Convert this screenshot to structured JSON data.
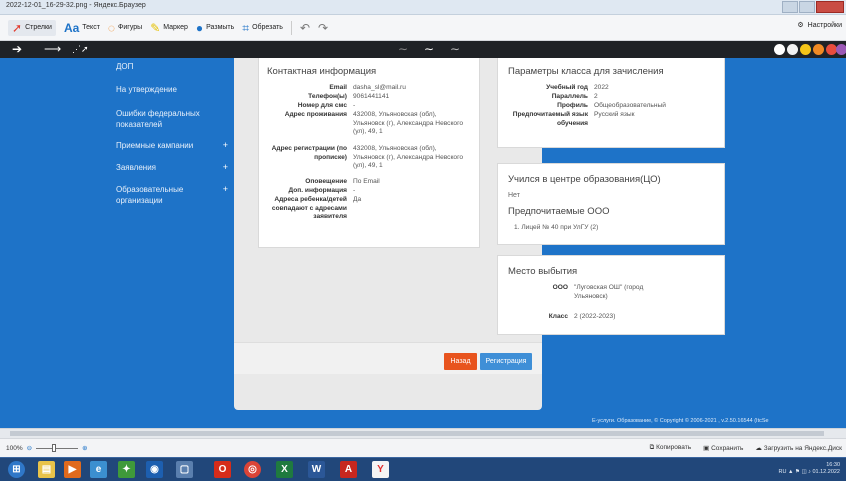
{
  "window": {
    "title": "2022-12-01_16-29-32.png - Яндекс.Браузер"
  },
  "toolbar": {
    "arrows": "Стрелки",
    "text": "Текст",
    "shapes": "Фигуры",
    "marker": "Маркер",
    "blur": "Размыть",
    "crop": "Обрезать",
    "settings": "Настройки"
  },
  "palette": [
    "#ffffff",
    "#f2f2f2",
    "#f5c518",
    "#f08a24",
    "#e84c3d",
    "#9b59b6",
    "#2ecc71"
  ],
  "sidebar": {
    "items": [
      {
        "label": "ДОП",
        "plus": ""
      },
      {
        "label": "На утверждение",
        "plus": ""
      },
      {
        "label": "Ошибки федеральных показателей",
        "plus": ""
      },
      {
        "label": "Приемные кампании",
        "plus": "+"
      },
      {
        "label": "Заявления",
        "plus": "+"
      },
      {
        "label": "Образовательные организации",
        "plus": "+"
      }
    ]
  },
  "contact": {
    "title": "Контактная информация",
    "rows": [
      {
        "k": "Email",
        "v": "dasha_sl@mail.ru"
      },
      {
        "k": "Телефон(ы)",
        "v": "9061441141"
      },
      {
        "k": "Номер для смс",
        "v": "-"
      },
      {
        "k": "Адрес проживания",
        "v": "432008, Ульяновская (обл), Ульяновск (г), Александра Невского (ул), 49, 1"
      },
      {
        "k": "Адрес регистрации (по прописке)",
        "v": "432008, Ульяновская (обл), Ульяновск (г), Александра Невского (ул), 49, 1"
      },
      {
        "k": "Оповещение",
        "v": "По Email"
      },
      {
        "k": "Доп. информация",
        "v": "-"
      },
      {
        "k": "Адреса ребенка/детей совпадают с адресами заявителя",
        "v": "Да"
      }
    ]
  },
  "class_params": {
    "title": "Параметры класса для зачисления",
    "rows": [
      {
        "k": "Учебный год",
        "v": "2022"
      },
      {
        "k": "Параллель",
        "v": "2"
      },
      {
        "k": "Профиль",
        "v": "Общеобразовательный"
      },
      {
        "k": "Предпочитаемый язык обучения",
        "v": "Русский язык"
      }
    ]
  },
  "edu_center": {
    "title": "Учился в центре образования(ЦО)",
    "value": "Нет",
    "preferred_title": "Предпочитаемые ООО",
    "preferred_item": "1. Лицей № 40 при УлГУ (2)"
  },
  "departure": {
    "title": "Место выбытия",
    "ooo_label": "ООО",
    "ooo_value": "\"Луговская ОШ\" (город Ульяновск)",
    "class_label": "Класс",
    "class_value": "2 (2022-2023)"
  },
  "actions": {
    "back": "Назад",
    "register": "Регистрация"
  },
  "footer": "Е-услуги. Образование, © Copyright © 2006-2021 , v.2.50.16544 (ItcSe",
  "statusbar": {
    "zoom": "100%",
    "copy": "Копировать",
    "save": "Сохранить",
    "upload": "Загрузить на Яндекс.Диск"
  },
  "tray": {
    "lang": "RU",
    "time": "16:30",
    "date": "01.12.2022"
  }
}
